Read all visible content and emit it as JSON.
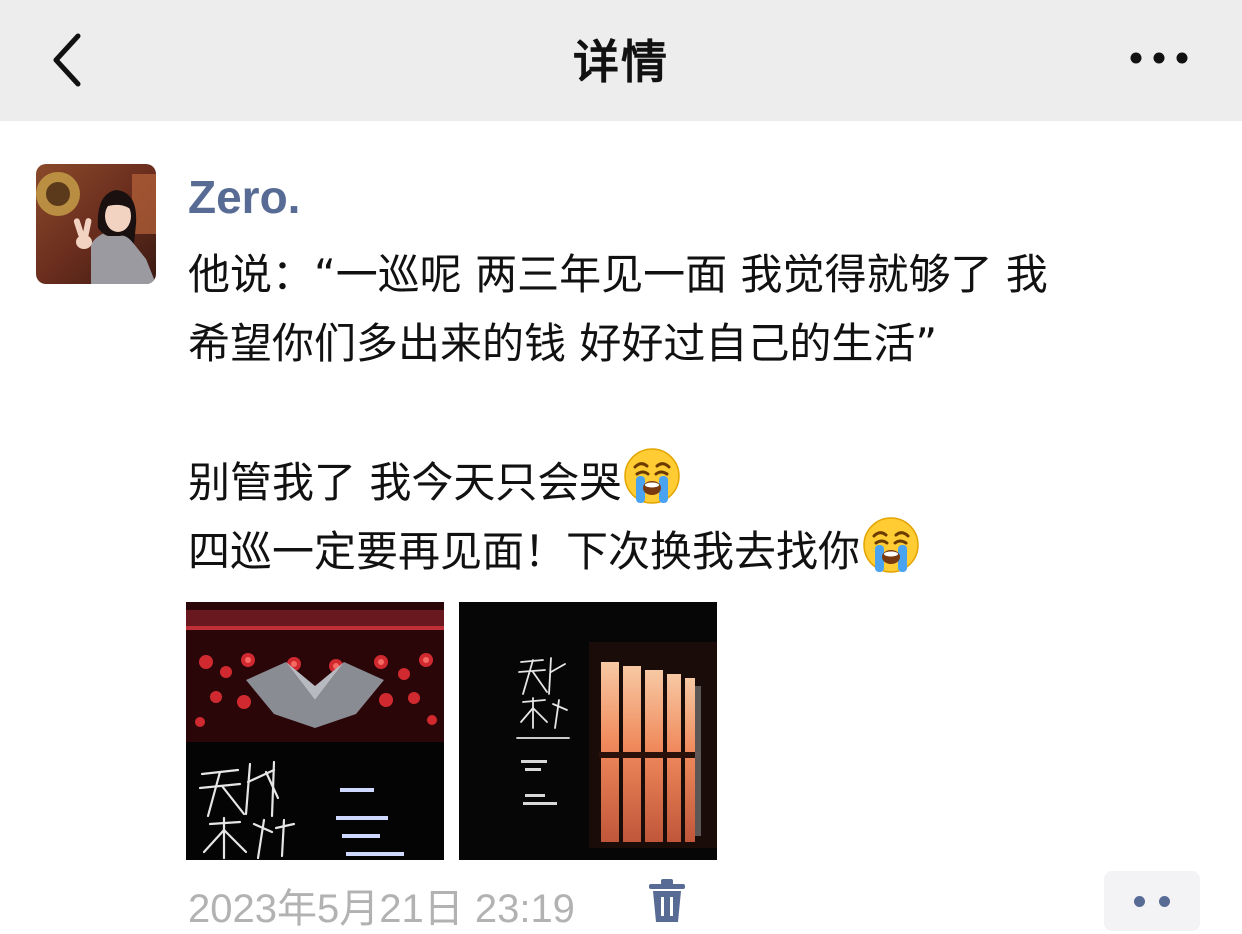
{
  "navbar": {
    "title": "详情",
    "back_icon": "chevron-left-icon",
    "more_icon": "more-horizontal-icon"
  },
  "post": {
    "author": "Zero.",
    "avatar_icon": "user-avatar",
    "lines": [
      "他说：“一巡呢 两三年见一面 我觉得就够了 我",
      "希望你们多出来的钱 好好过自己的生活”",
      "",
      "别管我了 我今天只会哭",
      "四巡一定要再见面！下次换我去找你"
    ],
    "emoji": "loudly-crying-face-emoji",
    "photos": [
      {
        "name": "concert-stage-photo",
        "poster_text": "天外来物"
      },
      {
        "name": "concert-poster-window-photo",
        "poster_text": "天外来物 巡回演唱会"
      }
    ],
    "timestamp": "2023年5月21日 23:19",
    "delete_icon": "trash-icon",
    "comment_icon": "two-dots-icon"
  },
  "colors": {
    "navbar_bg": "#ededed",
    "author_name": "#576b95",
    "timestamp": "#b2b2b2",
    "comment_dots": "#576b95"
  }
}
